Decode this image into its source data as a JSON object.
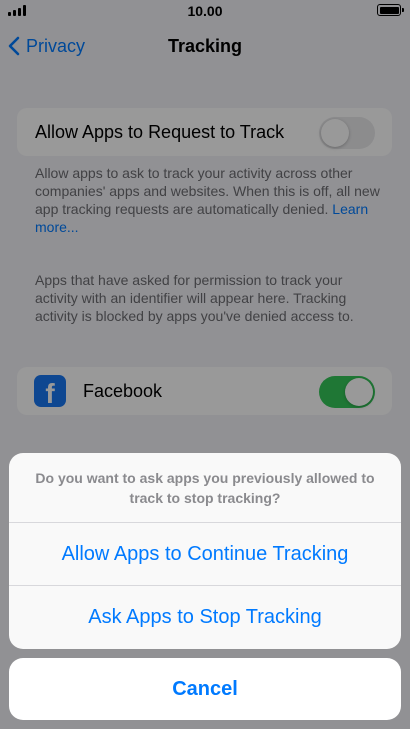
{
  "status_bar": {
    "time": "10.00"
  },
  "nav": {
    "back_label": "Privacy",
    "title": "Tracking"
  },
  "allow_tracking": {
    "label": "Allow Apps to Request to Track",
    "toggle_state": "off",
    "description": "Allow apps to ask to track your activity across other companies' apps and websites. When this is off, all new app tracking requests are automatically denied.",
    "learn_more": "Learn more..."
  },
  "apps_note": "Apps that have asked for permission to track your activity with an identifier will appear here. Tracking activity is blocked by apps you've denied access to.",
  "apps": [
    {
      "icon": "facebook-icon",
      "name": "Facebook",
      "toggle_state": "on"
    }
  ],
  "action_sheet": {
    "message": "Do you want to ask apps you previously allowed to track to stop tracking?",
    "actions": [
      "Allow Apps to Continue Tracking",
      "Ask Apps to Stop Tracking"
    ],
    "cancel": "Cancel"
  },
  "colors": {
    "accent": "#007aff",
    "toggle_on": "#34c759",
    "facebook": "#1877f2"
  }
}
